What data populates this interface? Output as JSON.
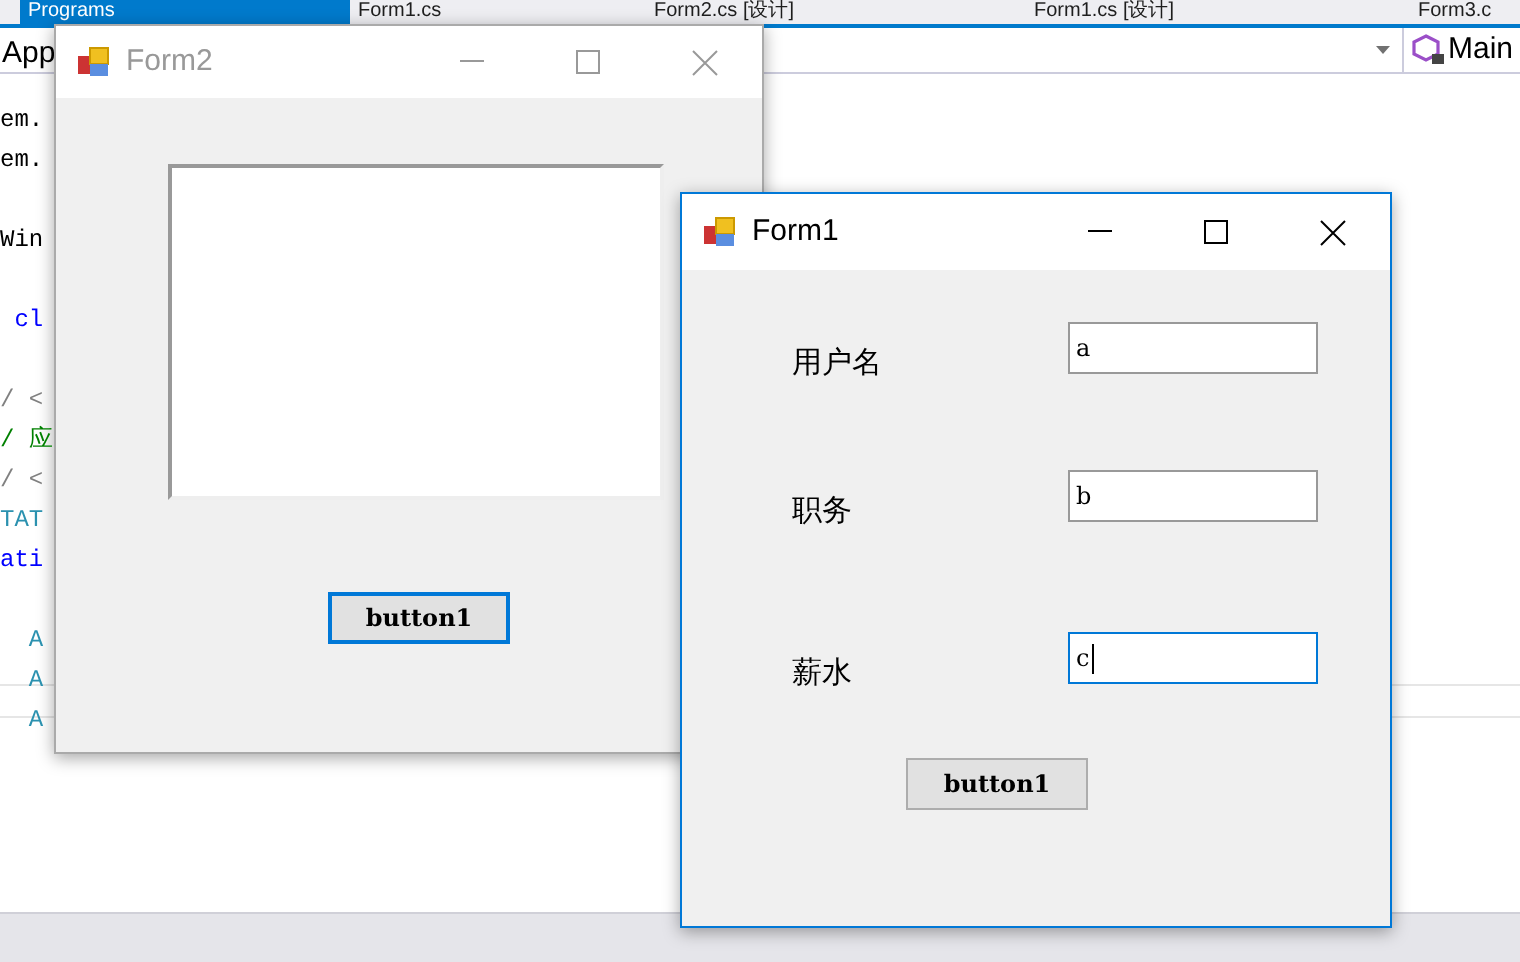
{
  "ide": {
    "tabs": [
      {
        "label": "Programs",
        "selected": true
      },
      {
        "label": "Form1.cs",
        "selected": false
      },
      {
        "label": "Form2.cs [设计]",
        "selected": false
      },
      {
        "label": "Form1.cs [设计]",
        "selected": false
      },
      {
        "label": "Form3.c",
        "selected": false
      }
    ],
    "project_combo": "App",
    "member_combo": "Main",
    "code_lines": [
      {
        "text": "em.",
        "kind": "plain"
      },
      {
        "text": "em.",
        "kind": "plain"
      },
      {
        "kind": "blank"
      },
      {
        "text": "Win",
        "kind": "plain"
      },
      {
        "kind": "blank"
      },
      {
        "text": " cl",
        "kind": "keyword"
      },
      {
        "kind": "blank"
      },
      {
        "text": "/ <",
        "kind": "comment"
      },
      {
        "text": "/ 应",
        "kind": "doc"
      },
      {
        "text": "/ <",
        "kind": "comment"
      },
      {
        "text": "TAT",
        "kind": "type"
      },
      {
        "text": "ati",
        "kind": "keyword"
      },
      {
        "kind": "blank"
      },
      {
        "text": "  A",
        "kind": "type"
      },
      {
        "text": "  A",
        "kind": "type"
      },
      {
        "text": "  A",
        "kind": "type"
      }
    ]
  },
  "form2": {
    "title": "Form2",
    "active": false,
    "button": {
      "label": "button1",
      "default": true
    }
  },
  "form1": {
    "title": "Form1",
    "active": true,
    "fields": [
      {
        "label": "用户名",
        "value": "a",
        "focused": false
      },
      {
        "label": "职务",
        "value": "b",
        "focused": false
      },
      {
        "label": "薪水",
        "value": "c",
        "focused": true
      }
    ],
    "button": {
      "label": "button1",
      "default": false
    }
  }
}
